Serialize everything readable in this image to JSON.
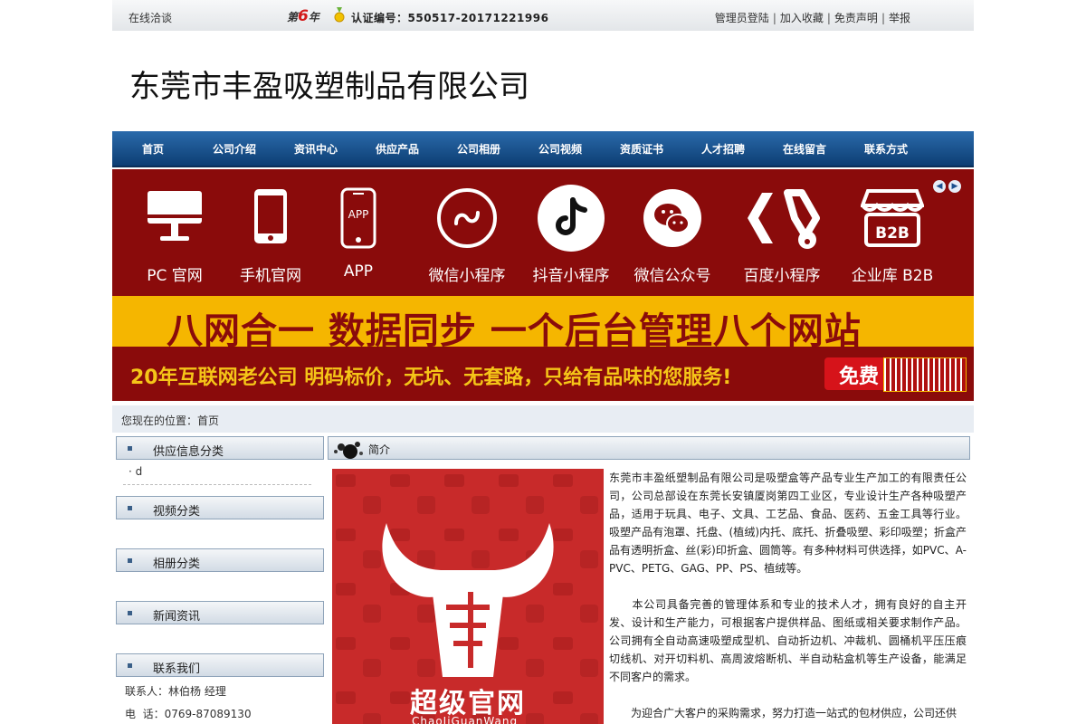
{
  "topbar": {
    "online": "在线洽谈",
    "year_prefix": "第",
    "year_num": "6",
    "year_suffix": "年",
    "cert": "认证编号：550517-20171221996",
    "links": [
      "管理员登陆",
      "加入收藏",
      "免责声明",
      "举报"
    ]
  },
  "company_name": "东莞市丰盈吸塑制品有限公司",
  "nav": [
    "首页",
    "公司介绍",
    "资讯中心",
    "供应产品",
    "公司相册",
    "公司视频",
    "资质证书",
    "人才招聘",
    "在线留言",
    "联系方式"
  ],
  "banner": {
    "icons": [
      {
        "label": "PC 官网",
        "icon": "monitor-icon"
      },
      {
        "label": "手机官网",
        "icon": "phone-icon"
      },
      {
        "label": "APP",
        "icon": "app-icon"
      },
      {
        "label": "微信小程序",
        "icon": "miniprogram-icon"
      },
      {
        "label": "抖音小程序",
        "icon": "douyin-icon"
      },
      {
        "label": "微信公众号",
        "icon": "wechat-icon"
      },
      {
        "label": "百度小程序",
        "icon": "baidu-icon"
      },
      {
        "label": "企业库 B2B",
        "icon": "b2b-store-icon"
      }
    ],
    "slogan": "八网合一  数据同步  一个后台管理八个网站",
    "subline": "20年互联网老公司  明码标价，无坑、无套路，只给有品味的您服务!",
    "free": "免费",
    "colors": {
      "bg": "#8a0b0b",
      "band": "#f5b600",
      "accent": "#f5c518"
    }
  },
  "location": "您现在的位置：首页",
  "sidebar": {
    "supply_title": "供应信息分类",
    "supply_items": [
      "· d"
    ],
    "video_title": "视频分类",
    "album_title": "相册分类",
    "news_title": "新闻资讯",
    "contact_title": "联系我们",
    "contact_person": "联系人：林伯杨 经理",
    "contact_phone": "电  话：0769-87089130"
  },
  "main": {
    "section_title": "简介",
    "promo_title": "超级官网",
    "promo_sub": "ChaoJiGuanWang",
    "paragraphs": [
      "东莞市丰盈纸塑制品有限公司是吸塑盒等产品专业生产加工的有限责任公司，公司总部设在东莞长安镇厦岗第四工业区，专业设计生产各种吸塑产品，适用于玩具、电子、文具、工艺品、食品、医药、五金工具等行业。吸塑产品有泡罩、托盘、(植绒)内托、底托、折叠吸塑、彩印吸塑；折盒产品有透明折盒、丝(彩)印折盒、圆筒等。有多种材料可供选择，如PVC、A-PVC、PETG、GAG、PP、PS、植绒等。",
      "　　本公司具备完善的管理体系和专业的技术人才，拥有良好的自主开发、设计和生产能力，可根据客户提供样品、图纸或相关要求制作产品。公司拥有全自动高速吸塑成型机、自动折边机、冲裁机、圆桶机平压压痕切线机、对开切料机、高周波熔断机、半自动粘盒机等生产设备，能满足不同客户的需求。",
      "　　为迎合广大客户的采购需求，努力打造一站式的包材供应，公司还供"
    ]
  }
}
